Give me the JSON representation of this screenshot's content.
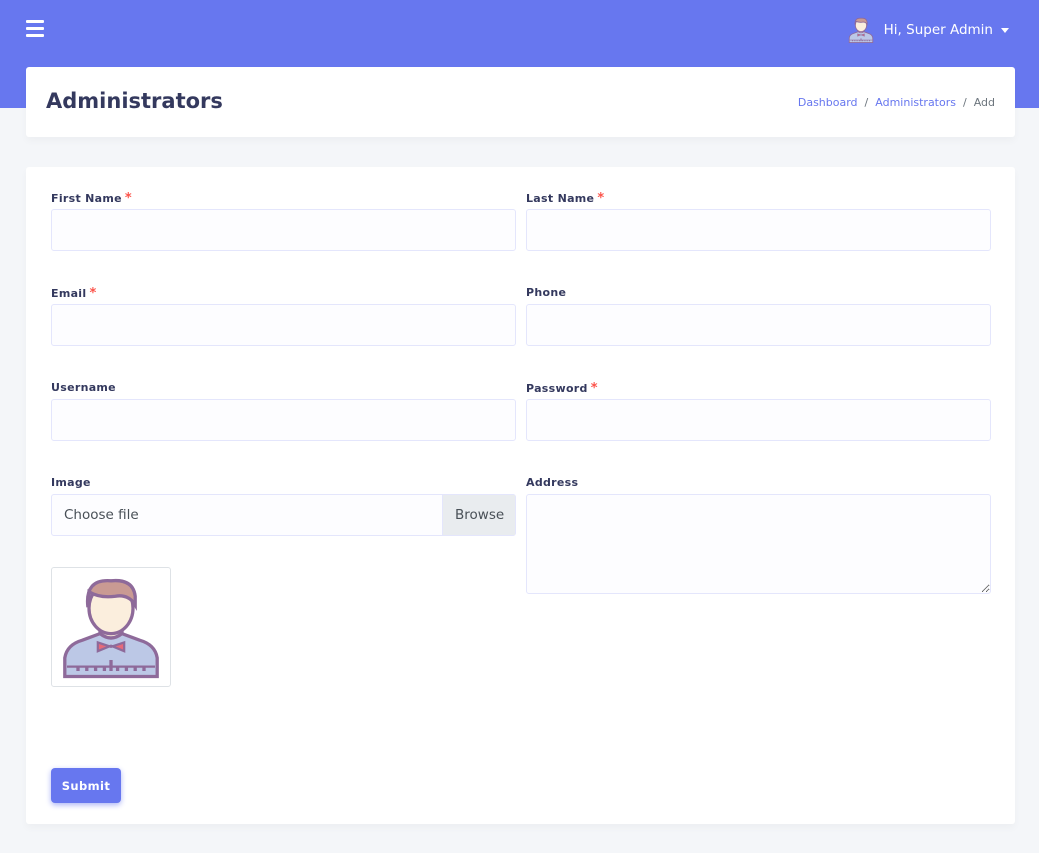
{
  "header": {
    "user_greeting": "Hi, Super Admin"
  },
  "page": {
    "title": "Administrators",
    "breadcrumb": [
      "Dashboard",
      "Administrators",
      "Add"
    ]
  },
  "form": {
    "first_name": {
      "label": "First Name",
      "required": "*",
      "value": ""
    },
    "last_name": {
      "label": "Last Name",
      "required": "*",
      "value": ""
    },
    "email": {
      "label": "Email",
      "required": "*",
      "value": ""
    },
    "phone": {
      "label": "Phone",
      "value": ""
    },
    "username": {
      "label": "Username",
      "value": ""
    },
    "password": {
      "label": "Password",
      "required": "*",
      "value": ""
    },
    "image": {
      "label": "Image",
      "placeholder": "Choose file",
      "browse": "Browse"
    },
    "address": {
      "label": "Address",
      "value": ""
    },
    "submit": "Submit"
  },
  "colors": {
    "primary": "#6777ef",
    "required": "#fc544b"
  }
}
